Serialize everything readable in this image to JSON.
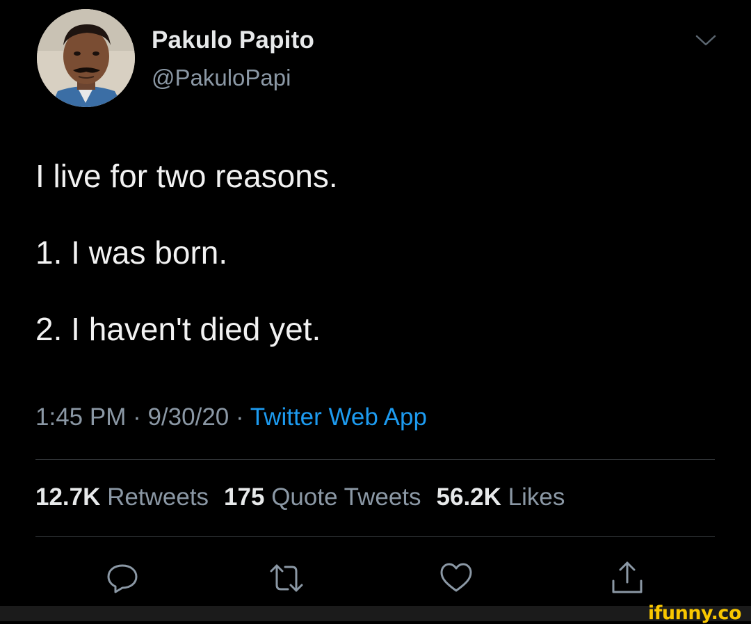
{
  "author": {
    "name": "Pakulo Papito",
    "handle": "@PakuloPapi",
    "avatar_icon": "profile-photo"
  },
  "tweet": {
    "lines": [
      "I live for two reasons.",
      "1. I was born.",
      "2. I haven't died yet."
    ]
  },
  "meta": {
    "time": "1:45 PM",
    "separator": " · ",
    "date": "9/30/20",
    "source": "Twitter Web App"
  },
  "stats": {
    "retweets_count": "12.7K",
    "retweets_label": "Retweets",
    "quotes_count": "175",
    "quotes_label": "Quote Tweets",
    "likes_count": "56.2K",
    "likes_label": "Likes"
  },
  "actions": [
    "reply-icon",
    "retweet-icon",
    "like-icon",
    "share-icon"
  ],
  "watermark": "ifunny.co",
  "colors": {
    "background": "#000000",
    "text_primary": "#e7e9ea",
    "text_secondary": "#8b98a5",
    "link": "#1d9bf0",
    "divider": "#2f3336",
    "watermark": "#f9c700"
  }
}
